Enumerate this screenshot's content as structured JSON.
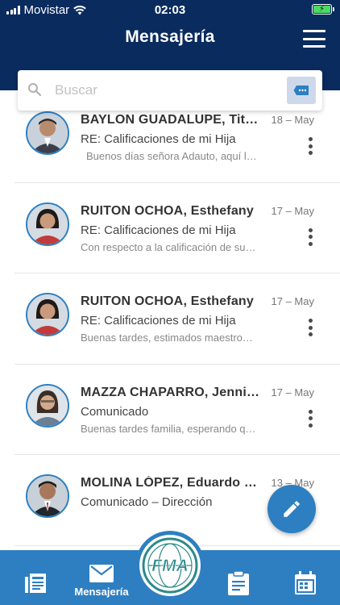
{
  "status_bar": {
    "carrier": "Movistar",
    "time": "02:03"
  },
  "header": {
    "title": "Mensajería"
  },
  "search": {
    "placeholder": "Buscar"
  },
  "messages": [
    {
      "sender": "BAYLON GUADALUPE, Tito Ronald",
      "date": "18 – May",
      "subject": "RE: Calificaciones de mi Hija",
      "preview": "Buenos días señora Adauto, aquí le envío"
    },
    {
      "sender": "RUITON OCHOA, Esthefany",
      "date": "17 – May",
      "subject": "RE: Calificaciones de mi Hija",
      "preview": "Con respecto a la calificación de su hija"
    },
    {
      "sender": "RUITON OCHOA, Esthefany",
      "date": "17 – May",
      "subject": "RE: Calificaciones de mi Hija",
      "preview": "Buenas tardes, estimados maestros y padres"
    },
    {
      "sender": "MAZZA CHAPARRO, Jennifer",
      "date": "17 – May",
      "subject": "Comunicado",
      "preview": "Buenas tardes familia, esperando que se encuentren"
    },
    {
      "sender": "MOLINA LÓPEZ, Eduardo Martín",
      "date": "13 – May",
      "subject": "Comunicado – Dirección",
      "preview": ""
    }
  ],
  "bottom_nav": {
    "messages_label": "Mensajería",
    "logo_text": "FMA"
  },
  "colors": {
    "header": "#0a2b5e",
    "accent": "#2d7fc1"
  }
}
